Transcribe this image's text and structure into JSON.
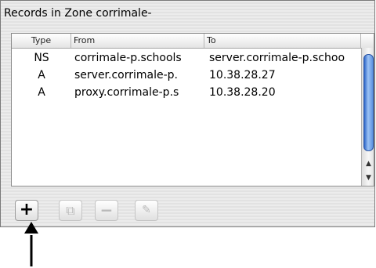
{
  "panel": {
    "title": "Records in Zone corrimale-"
  },
  "table": {
    "columns": [
      "Type",
      "From",
      "To"
    ],
    "rows": [
      {
        "type": "NS",
        "from": "corrimale-p.schools",
        "to": "server.corrimale-p.schoo"
      },
      {
        "type": "A",
        "from": "server.corrimale-p.",
        "to": "10.38.28.27"
      },
      {
        "type": "A",
        "from": "proxy.corrimale-p.s",
        "to": "10.38.28.20"
      }
    ]
  },
  "toolbar": {
    "add_label": "+",
    "duplicate_label": "⧉",
    "remove_label": "−",
    "edit_label": "✎"
  },
  "scroll": {
    "up_label": "▲",
    "down_label": "▼"
  }
}
